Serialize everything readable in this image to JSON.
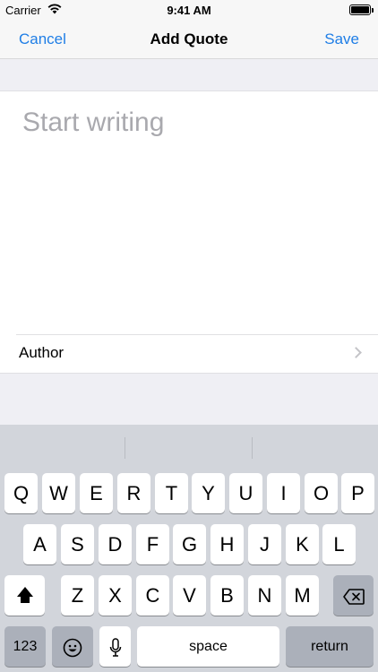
{
  "status_bar": {
    "carrier": "Carrier",
    "time": "9:41 AM",
    "wifi_icon": "wifi-icon",
    "battery_icon": "battery-icon"
  },
  "nav": {
    "cancel_label": "Cancel",
    "title": "Add Quote",
    "save_label": "Save",
    "accent_color": "#1f7ee6"
  },
  "form": {
    "quote_placeholder": "Start writing",
    "quote_value": "",
    "author_label": "Author"
  },
  "keyboard": {
    "row1": [
      "Q",
      "W",
      "E",
      "R",
      "T",
      "Y",
      "U",
      "I",
      "O",
      "P"
    ],
    "row2": [
      "A",
      "S",
      "D",
      "F",
      "G",
      "H",
      "J",
      "K",
      "L"
    ],
    "row3": [
      "Z",
      "X",
      "C",
      "V",
      "B",
      "N",
      "M"
    ],
    "numbers_label": "123",
    "space_label": "space",
    "return_label": "return"
  }
}
